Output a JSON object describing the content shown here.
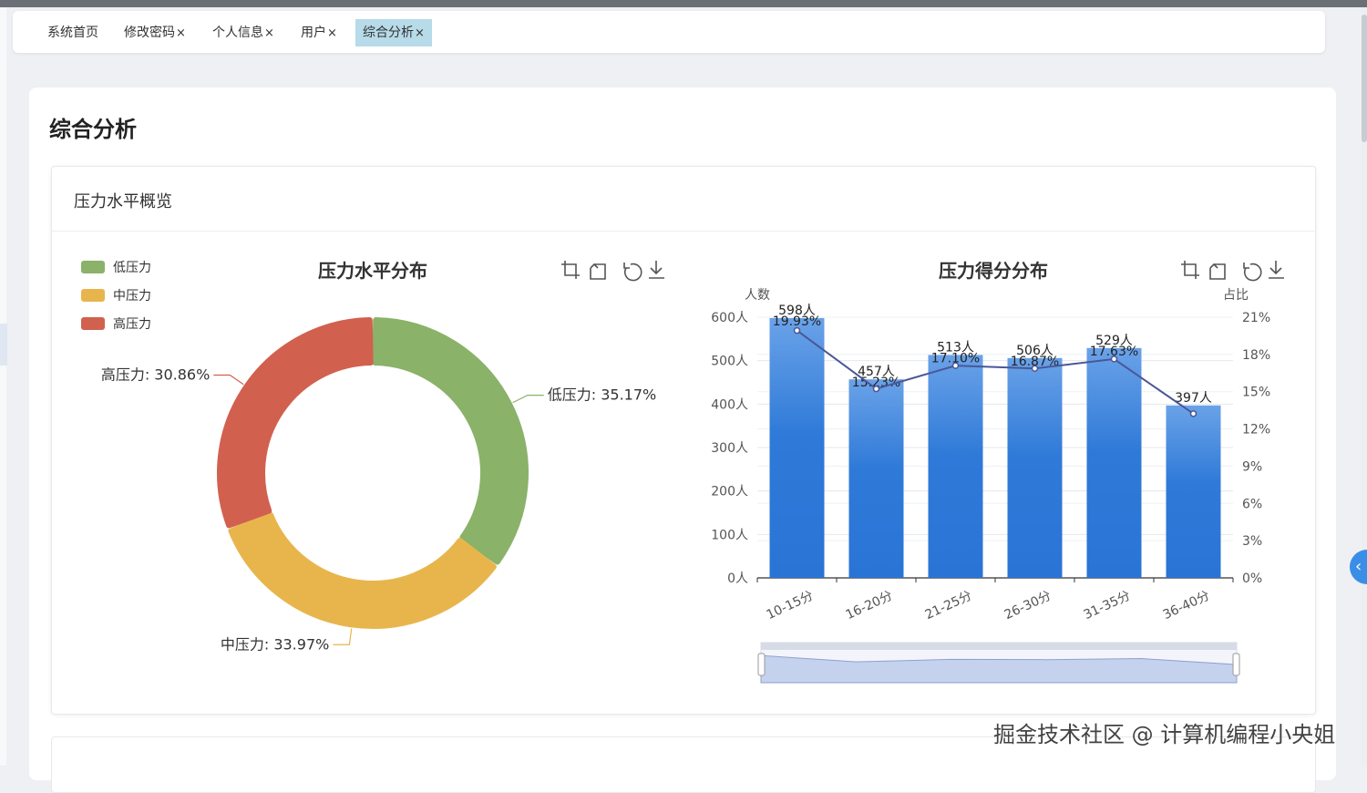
{
  "tabs": [
    {
      "label": "系统首页",
      "closable": false,
      "active": false
    },
    {
      "label": "修改密码",
      "closable": true,
      "active": false
    },
    {
      "label": "个人信息",
      "closable": true,
      "active": false
    },
    {
      "label": "用户",
      "closable": true,
      "active": false
    },
    {
      "label": "综合分析",
      "closable": true,
      "active": true
    }
  ],
  "close_glyph": "×",
  "page": {
    "title": "综合分析"
  },
  "card": {
    "title": "压力水平概览"
  },
  "toolbox_icons": [
    "zoom-icon",
    "zoom-reset-icon",
    "restore-icon",
    "download-icon"
  ],
  "watermark": "掘金技术社区 @ 计算机编程小央姐",
  "chart_data": [
    {
      "type": "pie",
      "title": "压力水平分布",
      "legend": [
        "低压力",
        "中压力",
        "高压力"
      ],
      "slices": [
        {
          "name": "低压力",
          "value": 35.17,
          "label": "低压力: 35.17%",
          "color": "#8ab269"
        },
        {
          "name": "中压力",
          "value": 33.97,
          "label": "中压力: 33.97%",
          "color": "#e8b54d"
        },
        {
          "name": "高压力",
          "value": 30.86,
          "label": "高压力: 30.86%",
          "color": "#d2604f"
        }
      ]
    },
    {
      "type": "bar",
      "title": "压力得分分布",
      "categories": [
        "10-15分",
        "16-20分",
        "21-25分",
        "26-30分",
        "31-35分",
        "36-40分"
      ],
      "series": [
        {
          "name": "人数",
          "type": "bar",
          "values": [
            598,
            457,
            513,
            506,
            529,
            397
          ],
          "labels": [
            "598人",
            "457人",
            "513人",
            "506人",
            "529人",
            "397人"
          ],
          "color": "#2e7ad9"
        },
        {
          "name": "占比",
          "type": "line",
          "values": [
            19.93,
            15.23,
            17.1,
            16.87,
            17.63,
            13.23
          ],
          "labels": [
            "19.93%",
            "15.23%",
            "17.10%",
            "16.87%",
            "17.63%",
            ""
          ],
          "color": "#4a5796"
        }
      ],
      "ylabel": "人数",
      "y2label": "占比",
      "ylim": [
        0,
        600
      ],
      "y2lim": [
        0,
        21
      ],
      "yticks": [
        "0人",
        "100人",
        "200人",
        "300人",
        "400人",
        "500人",
        "600人"
      ],
      "y2ticks": [
        "0%",
        "3%",
        "6%",
        "9%",
        "12%",
        "15%",
        "18%",
        "21%"
      ],
      "datazoom": true
    }
  ]
}
